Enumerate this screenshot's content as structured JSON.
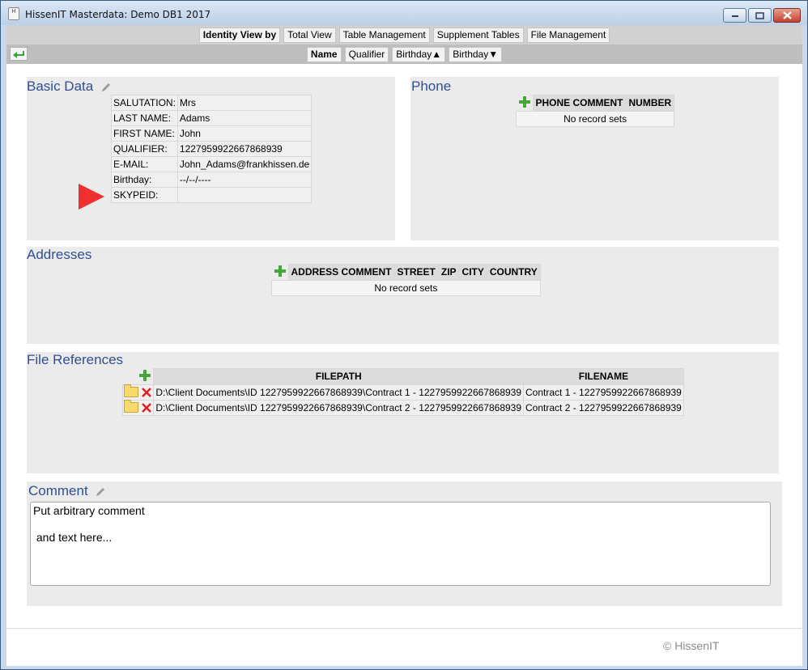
{
  "window": {
    "title": "HissenIT Masterdata: Demo DB1 2017",
    "app_icon_text": "H"
  },
  "nav": {
    "row1": [
      "Identity View by",
      "Total View",
      "Table Management",
      "Supplement Tables",
      "File Management"
    ],
    "row2": [
      "Name",
      "Qualifier",
      "Birthday▲",
      "Birthday▼"
    ]
  },
  "basic_data": {
    "title": "Basic Data",
    "rows": [
      {
        "label": "SALUTATION:",
        "value": "Mrs"
      },
      {
        "label": "LAST NAME:",
        "value": "Adams"
      },
      {
        "label": "FIRST NAME:",
        "value": "John"
      },
      {
        "label": "QUALIFIER:",
        "value": "1227959922667868939"
      },
      {
        "label": "E-MAIL:",
        "value": "John_Adams@frankhissen.de"
      },
      {
        "label": "Birthday:",
        "value": "--/--/----"
      },
      {
        "label": "SKYPEID:",
        "value": ""
      }
    ]
  },
  "phone": {
    "title": "Phone",
    "columns": [
      "PHONE COMMENT",
      "NUMBER"
    ],
    "empty_text": "No record sets"
  },
  "addresses": {
    "title": "Addresses",
    "columns": [
      "ADDRESS COMMENT",
      "STREET",
      "ZIP",
      "CITY",
      "COUNTRY"
    ],
    "empty_text": "No record sets"
  },
  "file_references": {
    "title": "File References",
    "columns": [
      "FILEPATH",
      "FILENAME"
    ],
    "rows": [
      {
        "filepath": "D:\\Client Documents\\ID 1227959922667868939\\Contract 1 - 1227959922667868939",
        "filename": "Contract 1 - 1227959922667868939"
      },
      {
        "filepath": "D:\\Client Documents\\ID 1227959922667868939\\Contract 2 - 1227959922667868939",
        "filename": "Contract 2 - 1227959922667868939"
      }
    ]
  },
  "comment": {
    "title": "Comment",
    "line1": "Put arbitrary comment",
    "line2": " and text here..."
  },
  "footer": {
    "copyright": "© HissenIT"
  },
  "colors": {
    "section_title": "#2f4f93",
    "add_icon": "#46a83a",
    "delete_icon": "#e02020",
    "marker_arrow": "#f03030"
  }
}
